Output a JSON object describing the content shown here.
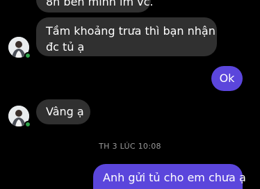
{
  "messages": [
    {
      "from": "them",
      "text": "8h bên mình lm vc."
    },
    {
      "from": "them",
      "line1": "Tầm khoảng trưa thì bạn nhận",
      "line2": "đc tủ ạ"
    },
    {
      "from": "me",
      "text": "Ok"
    },
    {
      "from": "them",
      "text": "Vâng ạ"
    },
    {
      "from": "me",
      "text": "Anh gửi tủ cho em chưa ạ"
    }
  ],
  "timestamp": "TH 3 LÚC 10:08",
  "colors": {
    "background": "#000000",
    "incoming_bubble": "#303030",
    "outgoing_bubble": "#5b46dc",
    "online_dot": "#31a24c"
  }
}
